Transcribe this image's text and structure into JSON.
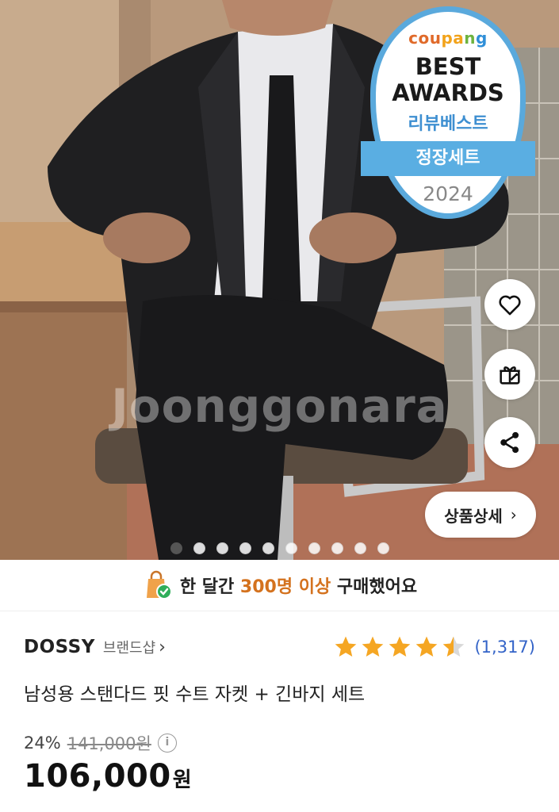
{
  "hero": {
    "watermark": "Joonggonara",
    "badge": {
      "brand_parts": [
        "cou",
        "pa",
        "n",
        "g"
      ],
      "line1": "BEST",
      "line2": "AWARDS",
      "line3": "리뷰베스트",
      "ribbon": "정장세트",
      "year": "2024"
    },
    "detail_button": "상품상세",
    "pagination": {
      "total": 10,
      "active": 0
    }
  },
  "purchase_banner": {
    "prefix": "한 달간 ",
    "highlight": "300명 이상",
    "suffix": " 구매했어요"
  },
  "product": {
    "brand": "DOSSY",
    "brand_shop": "브랜드샵",
    "rating": 4.5,
    "review_count": "(1,317)",
    "title": "남성용 스탠다드 핏 수트 자켓 + 긴바지 세트",
    "discount": "24%",
    "original_price": "141,000원",
    "price": "106,000",
    "price_unit": "원"
  },
  "colors": {
    "accent_orange": "#d4721e",
    "star": "#f5a623",
    "link_blue": "#3464c8",
    "badge_blue": "#5aaee2"
  },
  "icons": [
    "heart-icon",
    "gift-icon",
    "share-icon",
    "chevron-right-icon",
    "shopping-bag-check-icon",
    "star-icon",
    "info-icon"
  ]
}
